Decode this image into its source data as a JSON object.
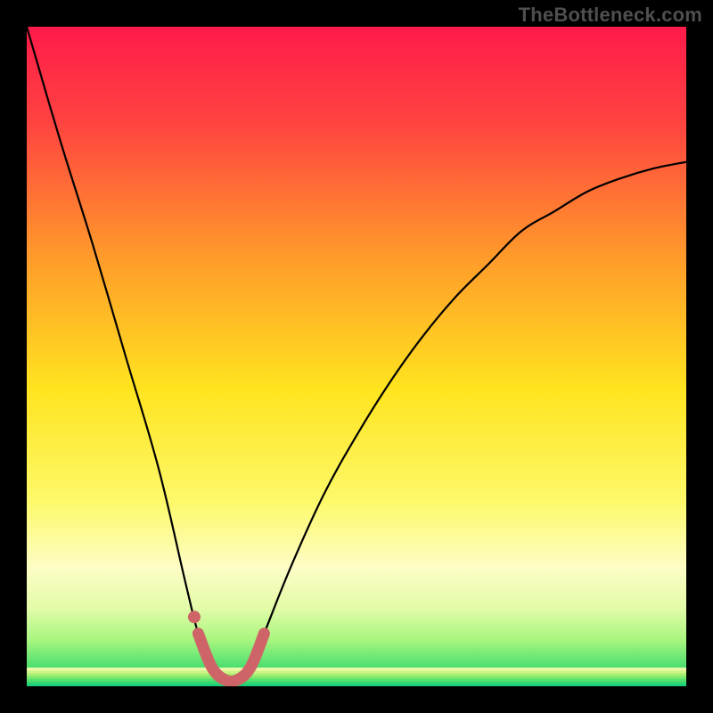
{
  "watermark": "TheBottleneck.com",
  "chart_data": {
    "type": "line",
    "title": "",
    "xlabel": "",
    "ylabel": "",
    "xlim": [
      0,
      100
    ],
    "ylim": [
      0,
      100
    ],
    "grid": false,
    "series": [
      {
        "name": "bottleneck-curve",
        "x": [
          0,
          5,
          10,
          15,
          20,
          24,
          26,
          28,
          30,
          32,
          34,
          36,
          40,
          45,
          50,
          55,
          60,
          65,
          70,
          75,
          80,
          85,
          90,
          95,
          100
        ],
        "values": [
          100,
          83,
          67,
          50,
          33,
          16,
          8,
          3,
          1,
          1,
          3,
          8,
          18,
          29,
          38,
          46,
          53,
          59,
          64,
          69,
          72,
          75,
          77,
          78.5,
          79.5
        ]
      },
      {
        "name": "green-band",
        "x": [
          0,
          100
        ],
        "values": [
          0,
          0
        ],
        "band_height": 3
      },
      {
        "name": "highlight-segment",
        "x": [
          26,
          28,
          30,
          32,
          34,
          36
        ],
        "values": [
          8,
          3,
          1,
          1,
          3,
          8
        ]
      },
      {
        "name": "highlight-dot",
        "x": [
          25.4
        ],
        "values": [
          10.5
        ]
      }
    ],
    "colors": {
      "gradient_stops": [
        {
          "offset": 0.0,
          "color": "#ff1a4a"
        },
        {
          "offset": 0.15,
          "color": "#ff4540"
        },
        {
          "offset": 0.35,
          "color": "#ff9b2a"
        },
        {
          "offset": 0.55,
          "color": "#ffe41f"
        },
        {
          "offset": 0.72,
          "color": "#fdf96a"
        },
        {
          "offset": 0.82,
          "color": "#fdfdc5"
        },
        {
          "offset": 0.88,
          "color": "#e4fca9"
        },
        {
          "offset": 0.93,
          "color": "#a8f57f"
        },
        {
          "offset": 0.97,
          "color": "#4de070"
        },
        {
          "offset": 1.0,
          "color": "#19d07a"
        }
      ],
      "curve": "#000000",
      "highlight": "#cf6468"
    }
  }
}
